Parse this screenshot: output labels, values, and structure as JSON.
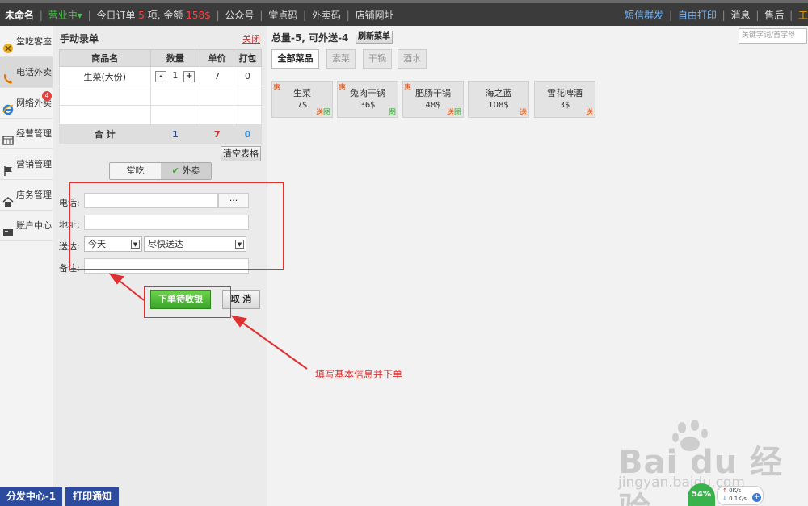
{
  "topbar": {
    "shop_name": "未命名",
    "status": "营业中▾",
    "today_orders_label": "今日订单",
    "today_orders_count": "5",
    "orders_unit": "项, 金额",
    "amount": "158$",
    "menu": [
      "公众号",
      "堂点码",
      "外卖码",
      "店铺网址"
    ],
    "right_links": [
      "短信群发",
      "自由打印"
    ],
    "right_items": [
      "消息",
      "售后",
      "工"
    ]
  },
  "sidebar": {
    "items": [
      {
        "label": "堂吃客座",
        "icon": "dine-in-icon"
      },
      {
        "label": "电话外卖",
        "icon": "phone-icon"
      },
      {
        "label": "网络外卖",
        "icon": "ie-icon",
        "badge": "4"
      },
      {
        "label": "经营管理",
        "icon": "calendar-icon"
      },
      {
        "label": "营销管理",
        "icon": "flag-icon"
      },
      {
        "label": "店务管理",
        "icon": "home-icon"
      },
      {
        "label": "账户中心",
        "icon": "card-icon"
      }
    ]
  },
  "order_panel": {
    "title": "手动录单",
    "close_label": "关闭",
    "columns": [
      "商品名",
      "数量",
      "单价",
      "打包"
    ],
    "rows": [
      {
        "name": "生菜(大份)",
        "qty": "1",
        "price": "7",
        "pack": "0"
      }
    ],
    "minus_label": "-",
    "plus_label": "+",
    "total": {
      "label": "合 计",
      "qty": "1",
      "price": "7",
      "pack": "0"
    },
    "clear_label": "清空表格",
    "mode_options": [
      "堂吃",
      "外卖"
    ],
    "selected_mode": "外卖",
    "form": {
      "phone_label": "电话:",
      "phone_value": "",
      "phone_more": "···",
      "address_label": "地址:",
      "address_value": "",
      "delivery_label": "送达:",
      "delivery_day": "今天",
      "delivery_time": "尽快送达",
      "note_label": "备注:",
      "note_value": ""
    },
    "submit_label": "下单待收银",
    "cancel_label": "取 消"
  },
  "menu_panel": {
    "summary": "总量-5, 可外送-4",
    "refresh_label": "刷新菜单",
    "search_placeholder": "关键字词/首字母",
    "categories": [
      "全部菜品",
      "素菜",
      "干锅",
      "酒水"
    ],
    "selected_category": "全部菜品",
    "dishes": [
      {
        "name": "生菜",
        "price": "7$",
        "hui": "惠",
        "tag_send": "送",
        "tag_img": "图"
      },
      {
        "name": "兔肉干锅",
        "price": "36$",
        "hui": "惠",
        "tag_send": "",
        "tag_img": "图"
      },
      {
        "name": "肥肠干锅",
        "price": "48$",
        "hui": "惠",
        "tag_send": "送",
        "tag_img": "图"
      },
      {
        "name": "海之蓝",
        "price": "108$",
        "hui": "",
        "tag_send": "送",
        "tag_img": ""
      },
      {
        "name": "雪花啤酒",
        "price": "3$",
        "hui": "",
        "tag_send": "送",
        "tag_img": ""
      }
    ]
  },
  "annotation": "填写基本信息并下单",
  "bottom": {
    "distribute_label": "分发中心-1",
    "print_label": "打印通知"
  },
  "network": {
    "percent": "54%",
    "up": "0K/s",
    "down": "0.1K/s"
  },
  "watermark": {
    "line1": "Bai du 经验",
    "line2": "jingyan.baidu.com"
  },
  "colors": {
    "accent_green": "#3aa52a",
    "annotation_red": "#d83030",
    "nav_blue": "#2c4b9e"
  }
}
